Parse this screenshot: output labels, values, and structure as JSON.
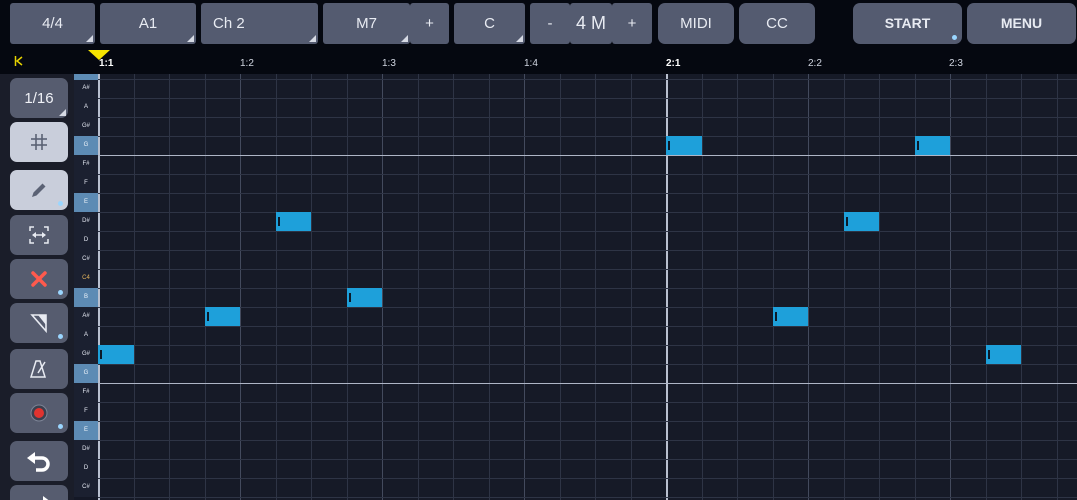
{
  "toolbar": {
    "time_signature": "4/4",
    "pattern": "A1",
    "channel": "Ch 2",
    "chord": "M7",
    "chord_plus": "+",
    "root_key": "C",
    "length_minus": "-",
    "length": "4 M",
    "length_plus": "+",
    "midi": "MIDI",
    "cc": "CC",
    "start": "START",
    "menu": "MENU"
  },
  "ruler": {
    "labels": [
      "1:1",
      "1:2",
      "1:3",
      "1:4",
      "2:1",
      "2:2",
      "2:3"
    ],
    "major": [
      "1:1",
      "2:1"
    ]
  },
  "sidebar": {
    "quantize": "1/16",
    "tools": [
      {
        "name": "grid-snap",
        "icon": "hash-icon"
      },
      {
        "name": "pencil",
        "icon": "pencil-icon"
      },
      {
        "name": "resize",
        "icon": "resize-horizontal-icon"
      },
      {
        "name": "delete",
        "icon": "x-icon"
      },
      {
        "name": "velocity",
        "icon": "velocity-wedge-icon"
      },
      {
        "name": "metronome",
        "icon": "metronome-icon"
      },
      {
        "name": "record",
        "icon": "record-icon"
      },
      {
        "name": "undo",
        "icon": "undo-icon"
      },
      {
        "name": "redo",
        "icon": "redo-icon"
      }
    ]
  },
  "piano": {
    "keys": [
      {
        "label": "A#",
        "style": "white"
      },
      {
        "label": "A",
        "style": "white"
      },
      {
        "label": "G#",
        "style": "white"
      },
      {
        "label": "G",
        "style": "blue"
      },
      {
        "label": "F#",
        "style": "white"
      },
      {
        "label": "F",
        "style": "white"
      },
      {
        "label": "E",
        "style": "blue"
      },
      {
        "label": "D#",
        "style": "white"
      },
      {
        "label": "D",
        "style": "white"
      },
      {
        "label": "C#",
        "style": "white"
      },
      {
        "label": "C4",
        "style": "c4"
      },
      {
        "label": "B",
        "style": "blue"
      },
      {
        "label": "A#",
        "style": "white"
      },
      {
        "label": "A",
        "style": "white"
      },
      {
        "label": "G#",
        "style": "white"
      },
      {
        "label": "G",
        "style": "blue"
      },
      {
        "label": "F#",
        "style": "white"
      },
      {
        "label": "F",
        "style": "white"
      },
      {
        "label": "E",
        "style": "blue"
      },
      {
        "label": "D#",
        "style": "white"
      },
      {
        "label": "D",
        "style": "white"
      },
      {
        "label": "C#",
        "style": "white"
      }
    ]
  },
  "notes": [
    {
      "pitch": "G#3",
      "step": 0,
      "length": 1
    },
    {
      "pitch": "A#3",
      "step": 3,
      "length": 1
    },
    {
      "pitch": "D#4",
      "step": 5,
      "length": 1
    },
    {
      "pitch": "B3",
      "step": 7,
      "length": 1
    },
    {
      "pitch": "G4",
      "step": 16,
      "length": 1
    },
    {
      "pitch": "A#3",
      "step": 19,
      "length": 1
    },
    {
      "pitch": "D#4",
      "step": 21,
      "length": 1
    },
    {
      "pitch": "G4",
      "step": 23,
      "length": 1
    },
    {
      "pitch": "G#3",
      "step": 25,
      "length": 1
    }
  ],
  "colors": {
    "note": "#1ea0da",
    "playhead": "#f5e400",
    "button": "#565c6f",
    "background": "#161a27"
  }
}
